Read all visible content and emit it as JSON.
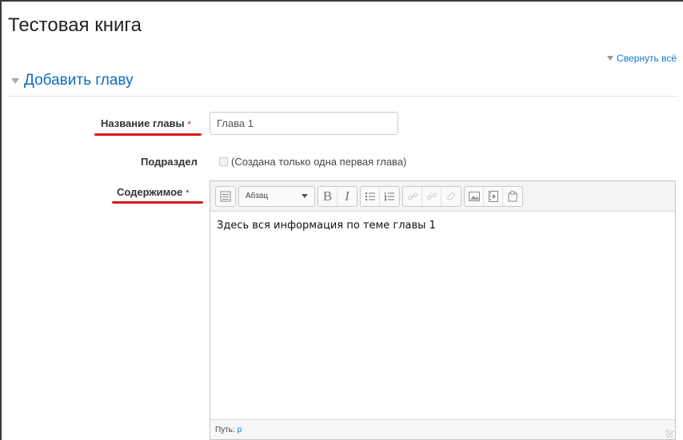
{
  "page": {
    "title": "Тестовая книга"
  },
  "collapse_all": "Свернуть всё",
  "section": {
    "title": "Добавить главу"
  },
  "fields": {
    "chapter_title": {
      "label": "Название главы",
      "value": "Глава 1"
    },
    "subchapter": {
      "label": "Подраздел",
      "checkbox_text": "(Создана только одна первая глава)"
    },
    "content": {
      "label": "Содержимое",
      "format_select": "Абзац",
      "text": "Здесь вся информация по теме главы 1",
      "path_label": "Путь:",
      "path_value": "p"
    }
  },
  "required_marker": "*",
  "colors": {
    "accent": "#0f6cbf",
    "required": "#cc0000",
    "underline": "#d41c1c"
  }
}
